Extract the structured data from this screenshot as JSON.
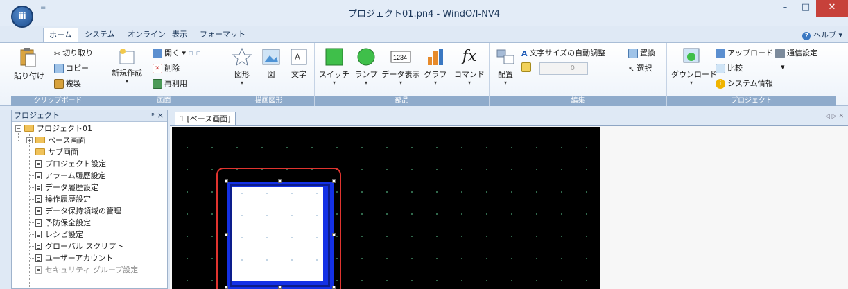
{
  "window": {
    "title": "プロジェクト01.pn4 - WindO/I-NV4",
    "app_button_label": "ⅲ",
    "qat_label": "=",
    "minimize": "–",
    "maximize": "□",
    "close": "✕"
  },
  "tabs": [
    "ホーム",
    "システム",
    "オンライン",
    "表示",
    "フォーマット"
  ],
  "help": "ヘルプ",
  "ribbon": {
    "clipboard": {
      "label": "クリップボード",
      "paste": "貼り付け",
      "cut": "切り取り",
      "copy": "コピー",
      "duplicate": "複製"
    },
    "screen": {
      "label": "画面",
      "new": "新規作成",
      "open": "開く",
      "delete": "削除",
      "reuse": "再利用"
    },
    "drawing": {
      "label": "描画図形",
      "shape": "図形",
      "figure": "図",
      "text": "文字"
    },
    "parts": {
      "label": "部品",
      "switch": "スイッチ",
      "lamp": "ランプ",
      "data_display": "データ表示",
      "data_icon_text": "1234",
      "graph": "グラフ",
      "command": "コマンド",
      "command_icon_text": "fx"
    },
    "edit": {
      "label": "編集",
      "arrange": "配置",
      "auto_font": "文字サイズの自動調整",
      "size_value": "0",
      "replace": "置換",
      "select": "選択"
    },
    "project": {
      "label": "プロジェクト",
      "download": "ダウンロード",
      "upload": "アップロード",
      "compare": "比較",
      "system_info": "システム情報",
      "comm_settings": "通信設定"
    }
  },
  "project_panel": {
    "title": "プロジェクト",
    "pin": "ᵖ",
    "close": "×",
    "root": "プロジェクト01",
    "items": [
      "ベース画面",
      "サブ画面",
      "プロジェクト設定",
      "アラーム履歴設定",
      "データ履歴設定",
      "操作履歴設定",
      "データ保持領域の管理",
      "予防保全設定",
      "レシピ設定",
      "グローバル スクリプト",
      "ユーザーアカウント",
      "セキュリティ グループ設定"
    ]
  },
  "editor": {
    "tab_label": "1 [ベース画面]",
    "nav": "◁ ▷ ✕"
  },
  "colors": {
    "canvas": "#000000",
    "switch_border": "#1431e6",
    "highlight": "#e0342f"
  }
}
